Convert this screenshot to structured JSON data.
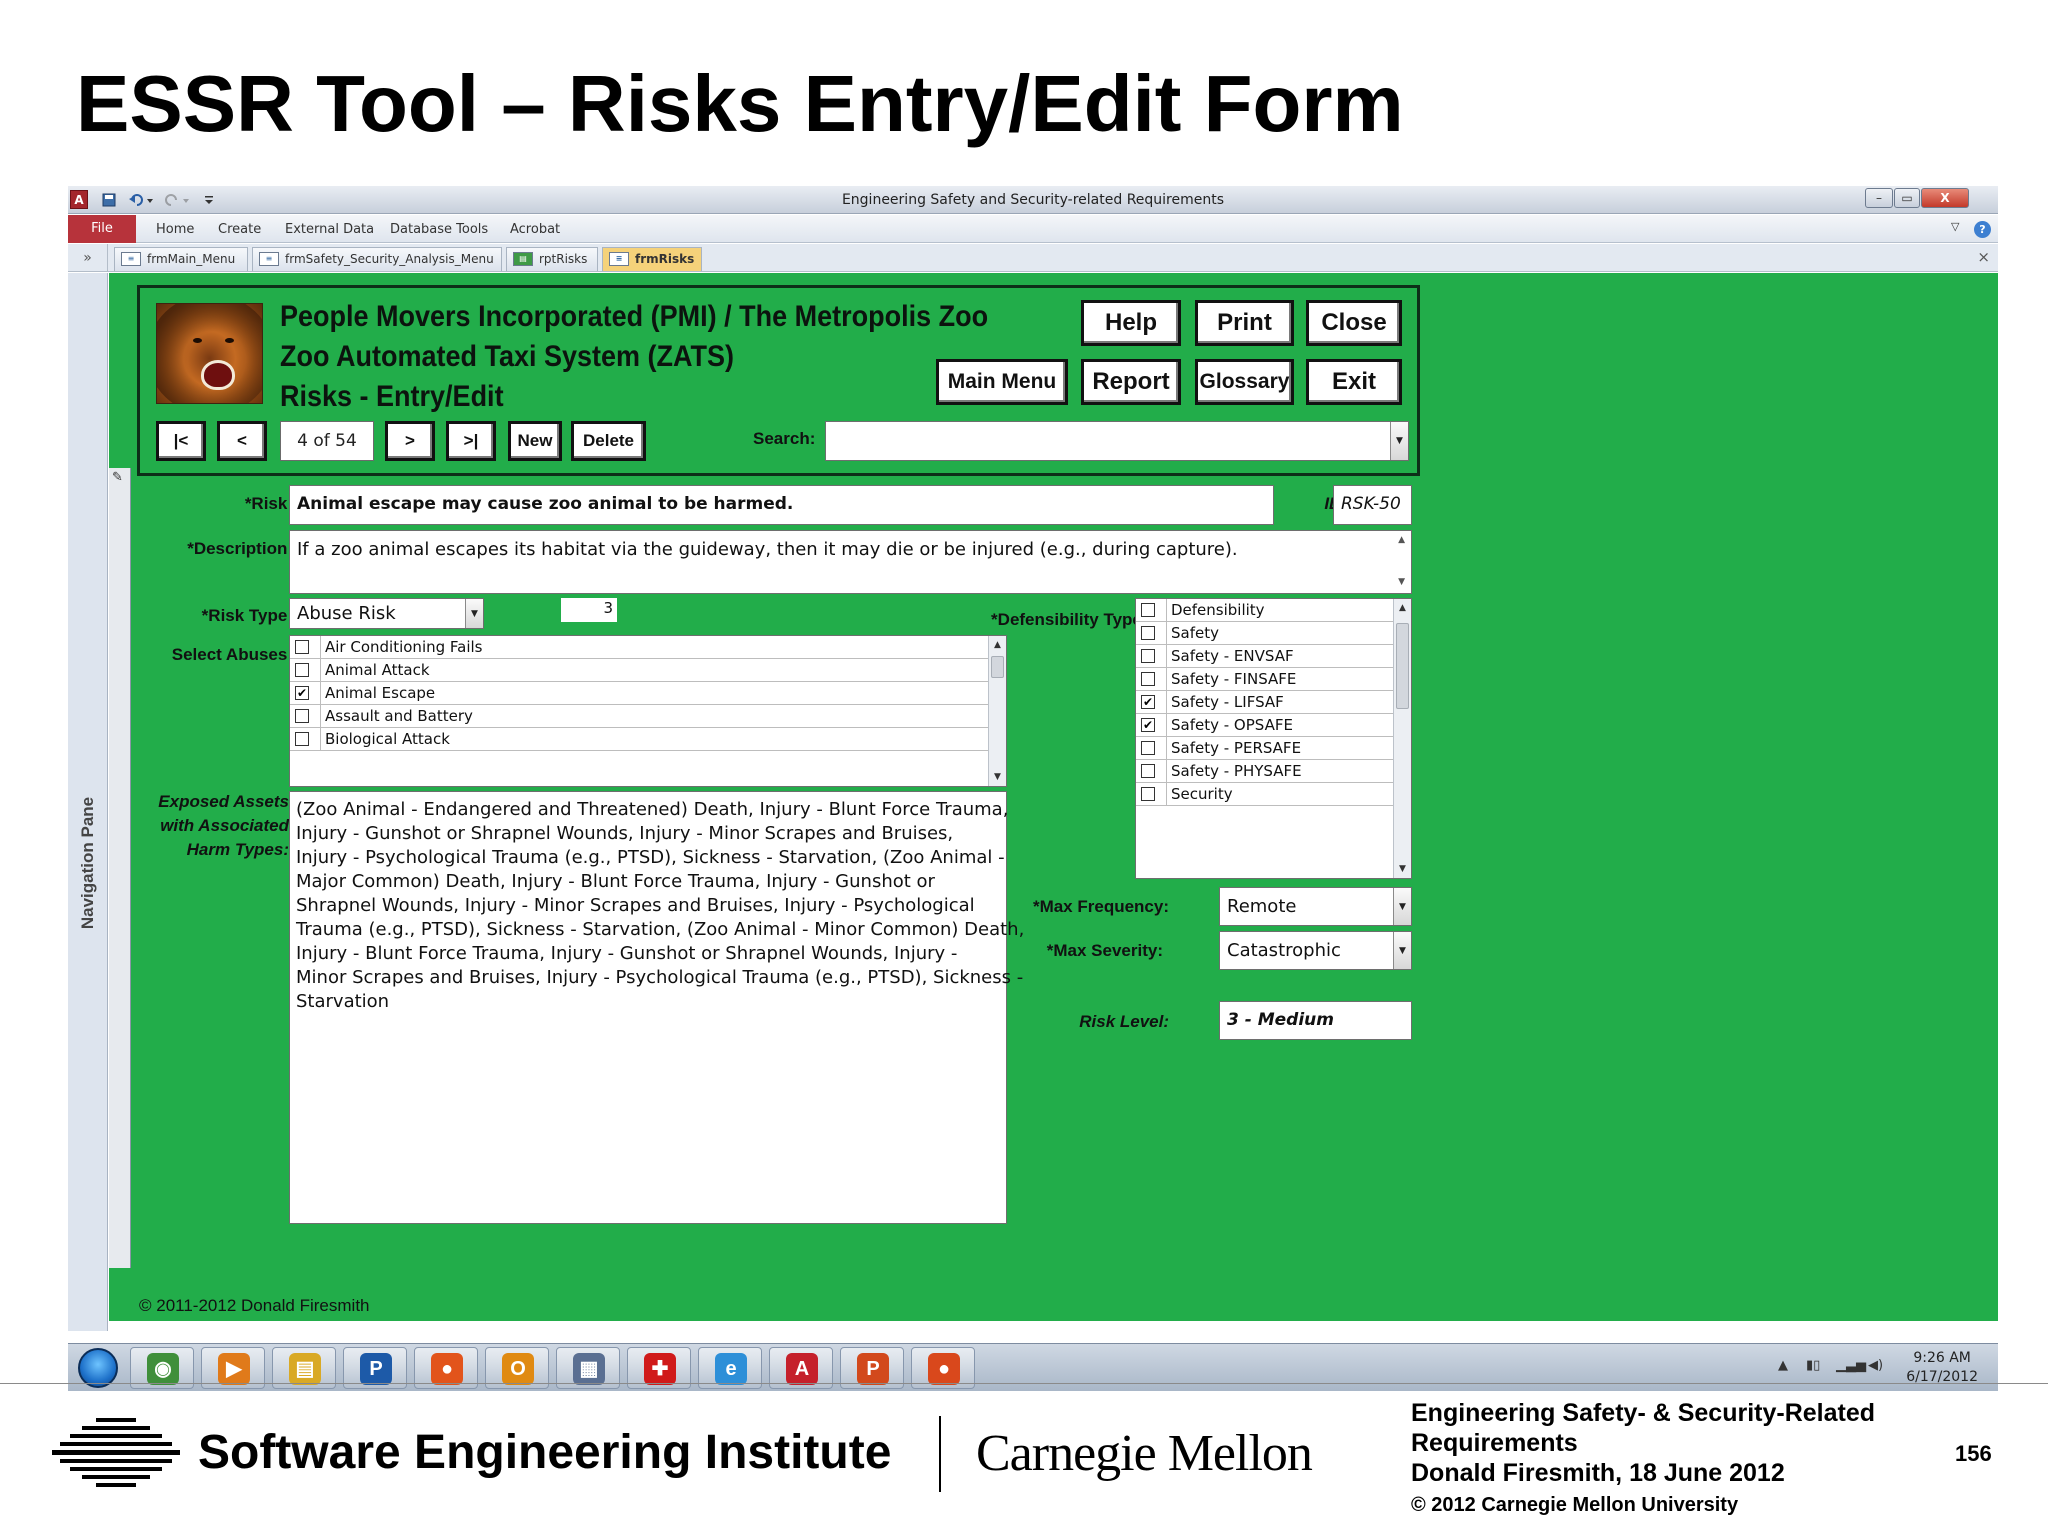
{
  "slide": {
    "title": "ESSR Tool – Risks Entry/Edit Form",
    "page_number": "156",
    "footer_lines": [
      "Engineering Safety- & Security-Related",
      "Requirements",
      "Donald Firesmith,  18 June 2012"
    ],
    "footer_copyright": "© 2012 Carnegie Mellon University",
    "sei_name": "Software Engineering Institute",
    "cmu_name": "Carnegie Mellon"
  },
  "window": {
    "title": "Engineering Safety and Security-related Requirements",
    "app_icon": "A",
    "controls": {
      "minimize": "–",
      "restore": "▭",
      "close": "X"
    }
  },
  "ribbon": {
    "file": "File",
    "tabs": [
      "Home",
      "Create",
      "External Data",
      "Database Tools",
      "Acrobat"
    ],
    "help": "?"
  },
  "doc_tabs": {
    "toggle": "»",
    "items": [
      "frmMain_Menu",
      "frmSafety_Security_Analysis_Menu",
      "rptRisks",
      "frmRisks"
    ],
    "active": "frmRisks",
    "close": "×"
  },
  "nav_pane": {
    "label": "Navigation Pane"
  },
  "form": {
    "header": {
      "line1": "People Movers Incorporated (PMI) / The Metropolis Zoo",
      "line2": "Zoo Automated Taxi System (ZATS)",
      "line3": "Risks - Entry/Edit"
    },
    "buttons": {
      "help": "Help",
      "print": "Print",
      "close": "Close",
      "main_menu": "Main Menu",
      "report": "Report",
      "glossary": "Glossary",
      "exit": "Exit"
    },
    "record_nav": {
      "first": "|<",
      "prev": "<",
      "counter": "4 of 54",
      "next": ">",
      "last": ">|",
      "new": "New",
      "delete": "Delete"
    },
    "search": {
      "label": "Search:",
      "value": ""
    },
    "risk": {
      "label": "*Risk:",
      "value": "Animal escape may cause zoo animal to be harmed."
    },
    "id": {
      "label": "ID:",
      "value": "RSK-50"
    },
    "description": {
      "label": "*Description:",
      "value": "If a zoo animal escapes its habitat via the guideway, then it may die or be injured (e.g., during capture)."
    },
    "risk_type": {
      "label": "*Risk Type:",
      "value": "Abuse Risk",
      "number": "3"
    },
    "abuses": {
      "label": "Select Abuses:",
      "items": [
        {
          "name": "Air Conditioning Fails",
          "checked": false
        },
        {
          "name": "Animal Attack",
          "checked": false
        },
        {
          "name": "Animal Escape",
          "checked": true
        },
        {
          "name": "Assault and Battery",
          "checked": false
        },
        {
          "name": "Biological Attack",
          "checked": false
        }
      ]
    },
    "defensibility": {
      "label": "*Defensibility Types:",
      "items": [
        {
          "name": "Defensibility",
          "checked": false
        },
        {
          "name": "Safety",
          "checked": false
        },
        {
          "name": "Safety - ENVSAF",
          "checked": false
        },
        {
          "name": "Safety - FINSAFE",
          "checked": false
        },
        {
          "name": "Safety - LIFSAF",
          "checked": true
        },
        {
          "name": "Safety - OPSAFE",
          "checked": true
        },
        {
          "name": "Safety - PERSAFE",
          "checked": false
        },
        {
          "name": "Safety - PHYSAFE",
          "checked": false
        },
        {
          "name": "Security",
          "checked": false
        }
      ]
    },
    "exposed_assets": {
      "label_lines": [
        "Exposed Assets",
        "with Associated",
        "Harm Types:"
      ],
      "lines": [
        "(Zoo Animal - Endangered and Threatened) Death, Injury - Blunt Force Trauma,",
        "Injury - Gunshot or Shrapnel Wounds, Injury - Minor Scrapes and Bruises,",
        "Injury - Psychological Trauma (e.g., PTSD), Sickness - Starvation, (Zoo Animal -",
        "Major Common) Death, Injury - Blunt Force Trauma, Injury - Gunshot or",
        "Shrapnel Wounds, Injury - Minor Scrapes and Bruises, Injury - Psychological",
        "Trauma (e.g., PTSD), Sickness - Starvation, (Zoo Animal - Minor Common) Death,",
        "Injury - Blunt Force Trauma, Injury - Gunshot or Shrapnel Wounds, Injury -",
        "Minor Scrapes and Bruises, Injury - Psychological Trauma (e.g., PTSD), Sickness -",
        "Starvation"
      ]
    },
    "max_frequency": {
      "label": "*Max Frequency:",
      "value": "Remote"
    },
    "max_severity": {
      "label": "*Max Severity:",
      "value": "Catastrophic"
    },
    "risk_level": {
      "label": "Risk Level:",
      "value": "3 - Medium"
    },
    "copyright": "© 2011-2012 Donald Firesmith"
  },
  "taskbar": {
    "apps": [
      {
        "name": "internet-explorer-shell-icon",
        "glyph": "◉",
        "color": "#3f8f3a"
      },
      {
        "name": "media-player-icon",
        "glyph": "▶",
        "color": "#e07a1a"
      },
      {
        "name": "file-explorer-icon",
        "glyph": "▤",
        "color": "#d9a925"
      },
      {
        "name": "publisher-icon",
        "glyph": "P",
        "color": "#1d5aa8"
      },
      {
        "name": "firefox-icon",
        "glyph": "●",
        "color": "#e2541b"
      },
      {
        "name": "outlook-icon",
        "glyph": "O",
        "color": "#e08a12"
      },
      {
        "name": "calendar-icon",
        "glyph": "▦",
        "color": "#5a6f92"
      },
      {
        "name": "medical-star-icon",
        "glyph": "✚",
        "color": "#d01a1a"
      },
      {
        "name": "ie-icon",
        "glyph": "e",
        "color": "#2d8fd8"
      },
      {
        "name": "acrobat-icon",
        "glyph": "A",
        "color": "#c5202b"
      },
      {
        "name": "powerpoint-icon",
        "glyph": "P",
        "color": "#d2491c"
      },
      {
        "name": "firefox2-icon",
        "glyph": "●",
        "color": "#d9481c"
      }
    ],
    "time": "9:26 AM",
    "date": "6/17/2012"
  }
}
